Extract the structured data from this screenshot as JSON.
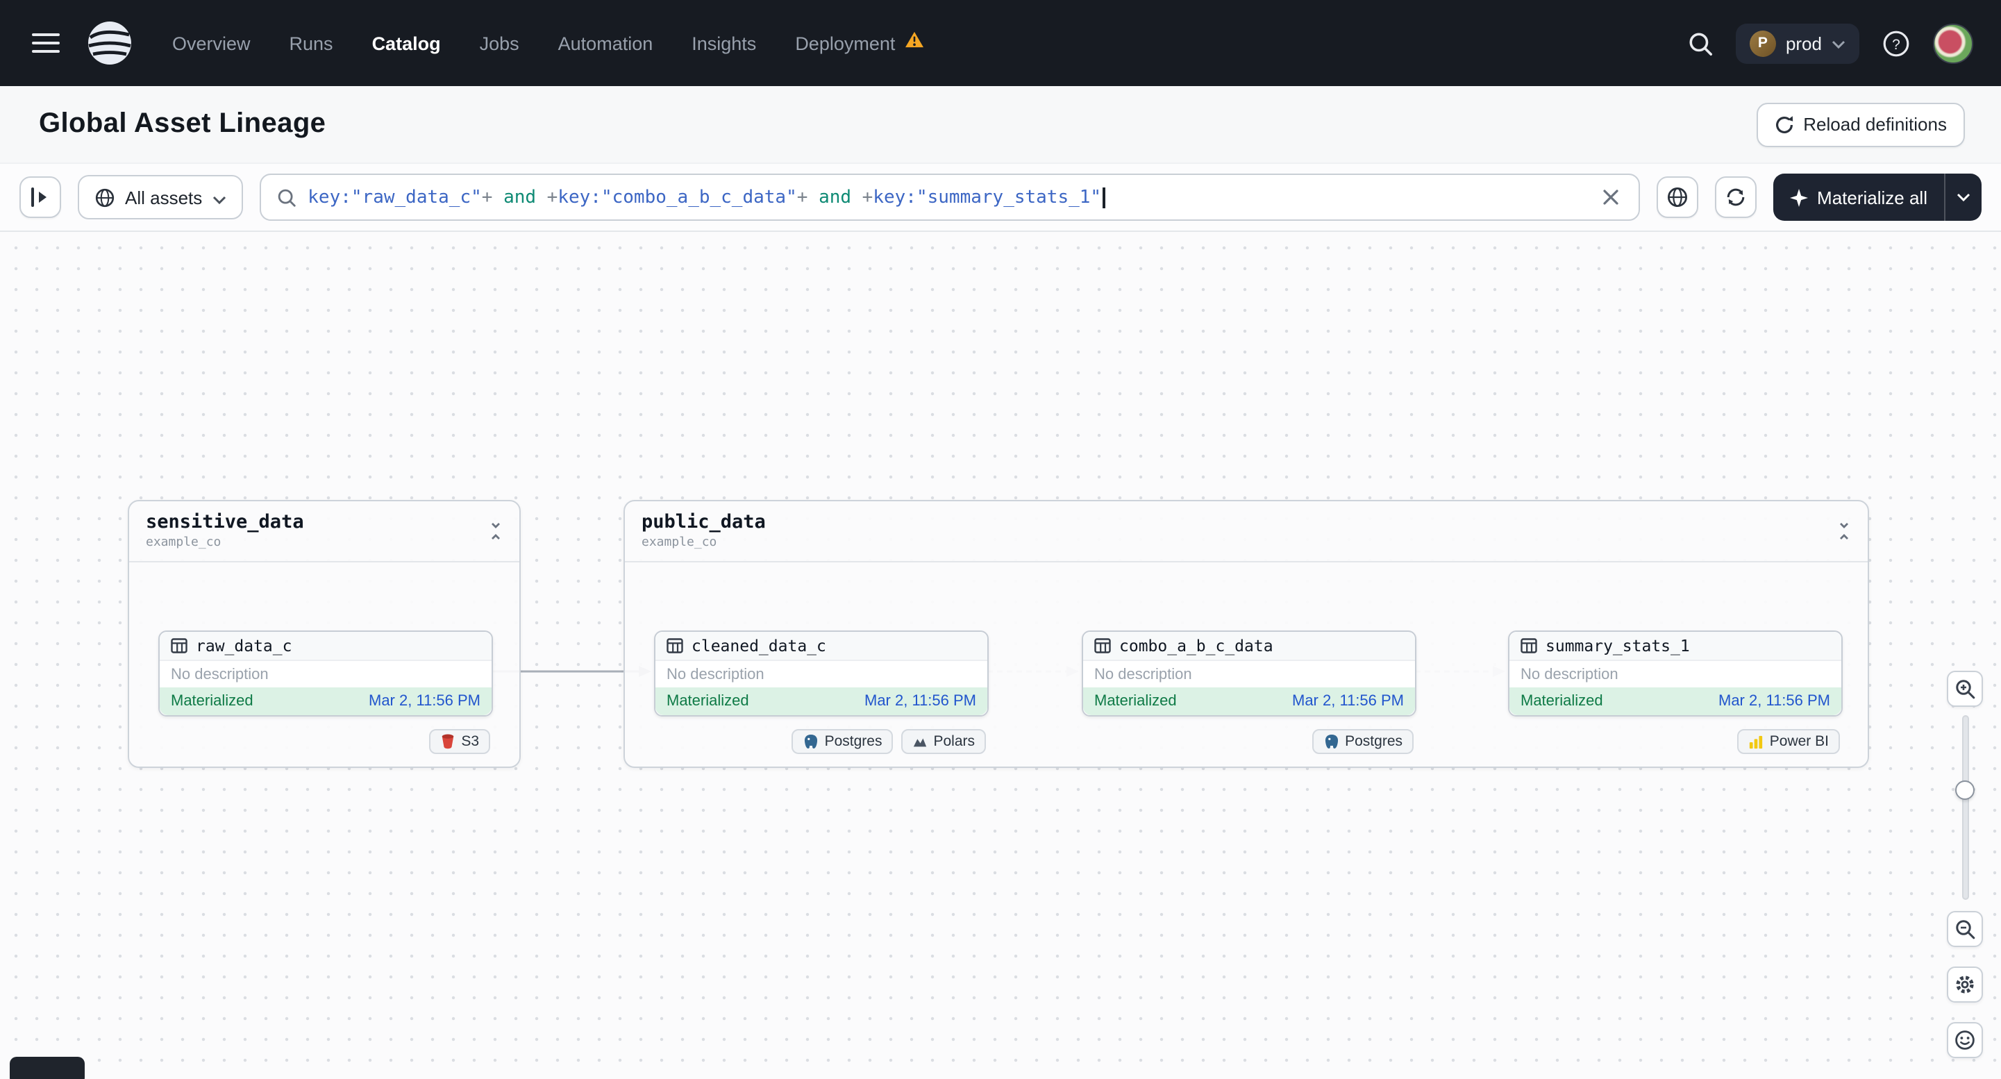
{
  "navbar": {
    "items": [
      "Overview",
      "Runs",
      "Catalog",
      "Jobs",
      "Automation",
      "Insights",
      "Deployment"
    ],
    "active_item": "Catalog",
    "env": {
      "initial": "P",
      "name": "prod"
    }
  },
  "header": {
    "title": "Global Asset Lineage",
    "reload_label": "Reload definitions"
  },
  "toolbar": {
    "scope_label": "All assets",
    "materialize_label": "Materialize all",
    "query_parts": [
      {
        "text": "key:"
      },
      {
        "text": "\"raw_data_c\""
      },
      {
        "text": "+ "
      },
      {
        "text": "and"
      },
      {
        "text": " +"
      },
      {
        "text": "key:"
      },
      {
        "text": "\"combo_a_b_c_data\""
      },
      {
        "text": "+ "
      },
      {
        "text": "and"
      },
      {
        "text": " +"
      },
      {
        "text": "key:"
      },
      {
        "text": "\"summary_stats_1\""
      }
    ]
  },
  "graph": {
    "groups": [
      {
        "name": "sensitive_data",
        "location": "example_co",
        "nodes": [
          {
            "name": "raw_data_c",
            "description": "No description",
            "status": "Materialized",
            "timestamp": "Mar 2, 11:56 PM",
            "tags": [
              {
                "label": "S3"
              }
            ]
          }
        ]
      },
      {
        "name": "public_data",
        "location": "example_co",
        "nodes": [
          {
            "name": "cleaned_data_c",
            "description": "No description",
            "status": "Materialized",
            "timestamp": "Mar 2, 11:56 PM",
            "tags": [
              {
                "label": "Postgres"
              },
              {
                "label": "Polars"
              }
            ]
          },
          {
            "name": "combo_a_b_c_data",
            "description": "No description",
            "status": "Materialized",
            "timestamp": "Mar 2, 11:56 PM",
            "tags": [
              {
                "label": "Postgres"
              }
            ]
          },
          {
            "name": "summary_stats_1",
            "description": "No description",
            "status": "Materialized",
            "timestamp": "Mar 2, 11:56 PM",
            "tags": [
              {
                "label": "Power BI"
              }
            ]
          }
        ]
      }
    ]
  },
  "colors": {
    "navbar_bg": "#171B22",
    "materialized_bg": "#DCF2E5",
    "materialized_text": "#0E7A46",
    "timestamp_link": "#2155CD",
    "warning": "#F5A623",
    "accent_button": "#1E2431"
  }
}
